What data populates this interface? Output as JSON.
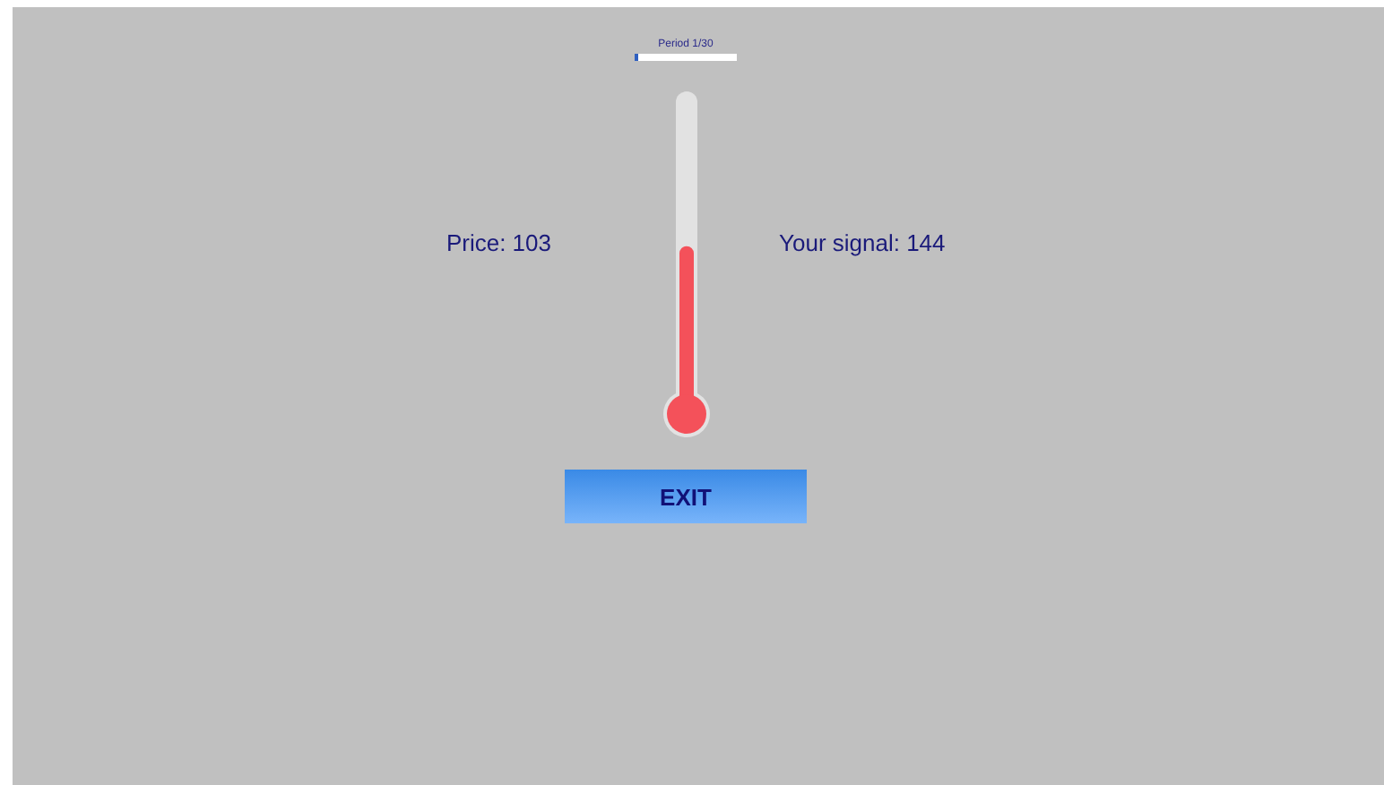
{
  "period": {
    "label": "Period 1/30",
    "level": 0.033
  },
  "price": "Price: 103",
  "thermometer": {
    "level": 0.51
  },
  "signal": "Your signal: 144",
  "button": "EXIT"
}
